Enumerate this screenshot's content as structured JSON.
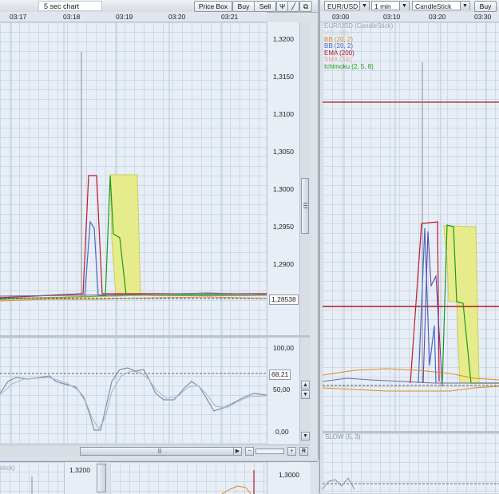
{
  "left_panel": {
    "chart_title": "5 sec chart",
    "toolbar": {
      "price_box_label": "Price Box",
      "buy_label": "Buy",
      "sell_label": "Sell"
    },
    "time_ticks": [
      "03:17",
      "03:18",
      "03:19",
      "03:20",
      "03:21"
    ],
    "price_axis": [
      "1,3200",
      "1,3150",
      "1,3100",
      "1,3050",
      "1,3000",
      "1,2950",
      "1,2900"
    ],
    "current_price": "1,28538",
    "osc_axis": [
      "100,00",
      "50,00",
      "0,00"
    ],
    "osc_value": "68,21",
    "scroll_thumb": "II",
    "scroll_right_button": "R"
  },
  "bottom_left": {
    "partial_label": "stick)",
    "price_label": "1,3200",
    "price_label_2": "1,3000"
  },
  "right_panel": {
    "symbol": "EUR/USD",
    "interval": "1 min",
    "chart_type": "CandleStick",
    "buy_label": "Buy",
    "time_ticks": [
      "03:00",
      "03:10",
      "03:20",
      "03:30"
    ],
    "legend": [
      {
        "text": "EUR/USD (CandleStick)",
        "color": "#9aa3b0"
      },
      {
        "text": "VOL(20)",
        "color": "#c7cdd5"
      },
      {
        "text": "BB (20, 2)",
        "color": "#e08a1e"
      },
      {
        "text": "BB (20, 2)",
        "color": "#4a68c8"
      },
      {
        "text": "EMA (200)",
        "color": "#b0181f"
      },
      {
        "text": "SMA (34)",
        "color": "#e6a0a8"
      },
      {
        "text": "Ichimoku (2, 5, 8)",
        "color": "#1a9a1a"
      }
    ],
    "osc_label": "SLOW (5, 3)"
  },
  "colors": {
    "window_bg": "#d4d8de",
    "chart_bg": "#e8eef6",
    "ema": "#b0181f",
    "ichimoku_cloud": "#e6ec8c",
    "bb_orange": "#e08a1e",
    "bb_blue": "#4a68c8",
    "tenkan": "#1a9a1a",
    "kijun": "#c0182a"
  }
}
